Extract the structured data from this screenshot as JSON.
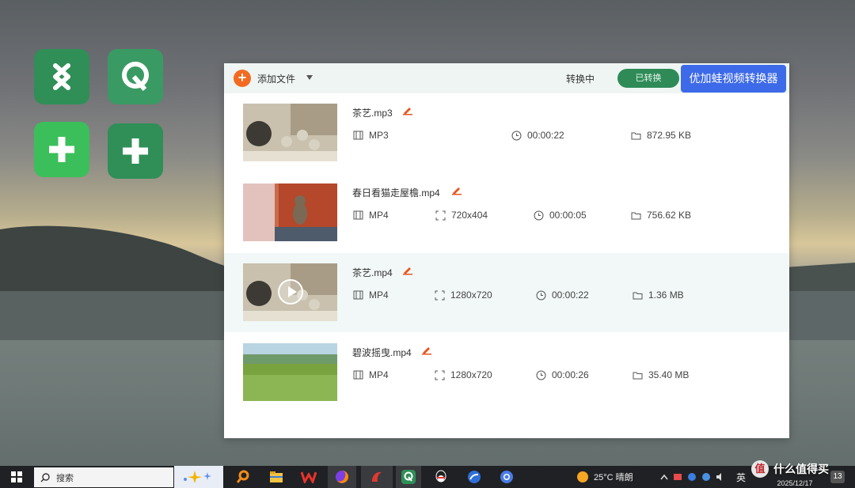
{
  "toolbar": {
    "add_label": "添加文件",
    "tab_converting": "转换中",
    "tab_converted": "已转换",
    "brand": "优加蛙视频转换器"
  },
  "files": [
    {
      "name": "茶艺.mp3",
      "format": "MP3",
      "resolution": "",
      "duration": "00:00:22",
      "size": "872.95 KB"
    },
    {
      "name": "春日看猫走屋檐.mp4",
      "format": "MP4",
      "resolution": "720x404",
      "duration": "00:00:05",
      "size": "756.62 KB"
    },
    {
      "name": "茶艺.mp4",
      "format": "MP4",
      "resolution": "1280x720",
      "duration": "00:00:22",
      "size": "1.36 MB"
    },
    {
      "name": "碧波摇曳.mp4",
      "format": "MP4",
      "resolution": "1280x720",
      "duration": "00:00:26",
      "size": "35.40 MB"
    }
  ],
  "taskbar": {
    "search_placeholder": "搜索",
    "weather": "25°C 晴朗",
    "ime": "英",
    "date": "2025/12/17",
    "notifications": "13"
  },
  "watermark": "什么值得买",
  "colors": {
    "accent": "#3d6ae8",
    "add": "#f26b21",
    "converted": "#2e8b57",
    "desktop_icon": "#2f8f57"
  }
}
